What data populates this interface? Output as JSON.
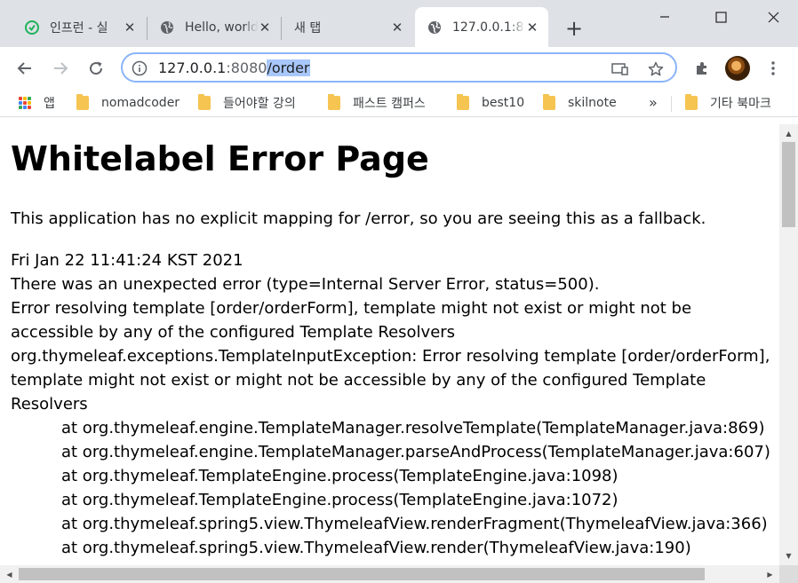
{
  "tabs": [
    {
      "title": "인프런 - 실",
      "favicon": "inflearn-icon",
      "active": false
    },
    {
      "title": "Hello, world",
      "favicon": "globe-icon",
      "active": false
    },
    {
      "title": "새 탭",
      "favicon": "",
      "active": false
    },
    {
      "title": "127.0.0.1:8",
      "favicon": "globe-icon",
      "active": true
    }
  ],
  "toolbar": {
    "url_host": "127.0.0.1",
    "url_port": ":8080",
    "url_path": "/order"
  },
  "bookmarks": {
    "items": [
      {
        "label": "앱",
        "icon": "apps-icon"
      },
      {
        "label": "nomadcoder",
        "icon": "folder-icon"
      },
      {
        "label": "들어야할 강의",
        "icon": "folder-icon"
      },
      {
        "label": "패스트 캠퍼스",
        "icon": "folder-icon"
      },
      {
        "label": "best10",
        "icon": "folder-icon"
      },
      {
        "label": "skilnote",
        "icon": "folder-icon"
      }
    ],
    "overflow_label": "»",
    "other_label": "기타 북마크"
  },
  "page": {
    "heading": "Whitelabel Error Page",
    "description": "This application has no explicit mapping for /error, so you are seeing this as a fallback.",
    "lines": [
      "Fri Jan 22 11:41:24 KST 2021",
      "There was an unexpected error (type=Internal Server Error, status=500).",
      "Error resolving template [order/orderForm], template might not exist or might not be",
      "accessible by any of the configured Template Resolvers",
      "org.thymeleaf.exceptions.TemplateInputException: Error resolving template [order/orderForm],",
      "template might not exist or might not be accessible by any of the configured Template",
      "Resolvers"
    ],
    "stack": [
      "at org.thymeleaf.engine.TemplateManager.resolveTemplate(TemplateManager.java:869)",
      "at org.thymeleaf.engine.TemplateManager.parseAndProcess(TemplateManager.java:607)",
      "at org.thymeleaf.TemplateEngine.process(TemplateEngine.java:1098)",
      "at org.thymeleaf.TemplateEngine.process(TemplateEngine.java:1072)",
      "at org.thymeleaf.spring5.view.ThymeleafView.renderFragment(ThymeleafView.java:366)",
      "at org.thymeleaf.spring5.view.ThymeleafView.render(ThymeleafView.java:190)"
    ]
  },
  "colors": {
    "tabstrip_bg": "#dee1e6",
    "omnibox_focus": "#8ab4f8",
    "url_selection": "#a8c7fa",
    "folder": "#f5c451"
  }
}
